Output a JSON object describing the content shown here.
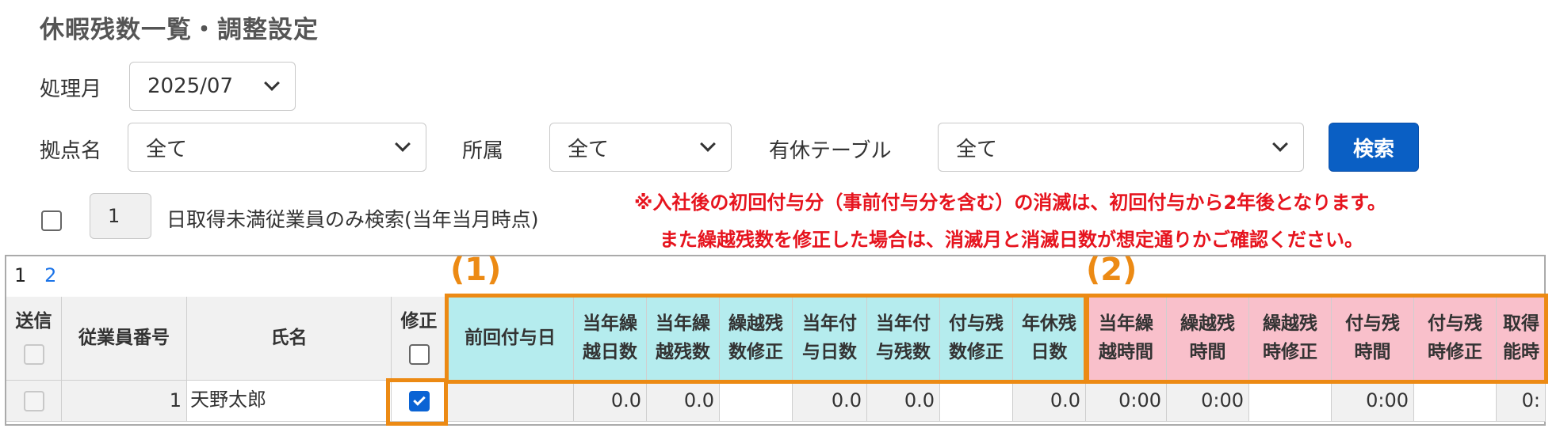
{
  "page_title": "休暇残数一覧・調整設定",
  "filters": {
    "month_label": "処理月",
    "month_value": "2025/07",
    "site_label": "拠点名",
    "site_value": "全て",
    "dept_label": "所属",
    "dept_value": "全て",
    "table_label": "有休テーブル",
    "table_value": "全て",
    "search_button": "検索",
    "days_value": "1",
    "days_checkbox_text": "日取得未満従業員のみ検索(当年当月時点)"
  },
  "notice": {
    "line1": "※入社後の初回付与分（事前付与分を含む）の消滅は、初回付与から2年後となります。",
    "line2": "また繰越残数を修正した場合は、消滅月と消滅日数が想定通りかご確認ください。"
  },
  "pager": {
    "current": "1",
    "next": "2"
  },
  "annotations": {
    "group1": "(1)",
    "group2": "(2)"
  },
  "colors": {
    "cyan_header": "#b5ecee",
    "pink_header": "#f9c0cb",
    "highlight": "#ec8a14",
    "primary_button": "#0a5fc4",
    "notice_text": "#e6141e"
  },
  "table": {
    "headers": {
      "send": "送信",
      "emp_no": "従業員番号",
      "name": "氏名",
      "modify": "修正",
      "c1": "前回付与日",
      "c2a": "当年繰",
      "c2b": "越日数",
      "c3a": "当年繰",
      "c3b": "越残数",
      "c4a": "繰越残",
      "c4b": "数修正",
      "c5a": "当年付",
      "c5b": "与日数",
      "c6a": "当年付",
      "c6b": "与残数",
      "c7a": "付与残",
      "c7b": "数修正",
      "c8a": "年休残",
      "c8b": "日数",
      "p1a": "当年繰",
      "p1b": "越時間",
      "p2a": "繰越残",
      "p2b": "時間",
      "p3a": "繰越残",
      "p3b": "時修正",
      "p4a": "付与残",
      "p4b": "時間",
      "p5a": "付与残",
      "p5b": "時修正",
      "p6a": "取得",
      "p6b": "能時"
    },
    "rows": [
      {
        "emp_no": "1",
        "name": "天野太郎",
        "last_grant_date": "",
        "carry_days": "0.0",
        "carry_remaining": "0.0",
        "carry_fix": "",
        "grant_days": "0.0",
        "grant_remaining": "0.0",
        "grant_fix": "",
        "annual_remaining": "0.0",
        "carry_hours": "0:00",
        "carry_rem_hours": "0:00",
        "carry_hour_fix": "",
        "grant_rem_hours": "0:00",
        "grant_hour_fix": "",
        "avail_hours": "0:"
      }
    ]
  }
}
